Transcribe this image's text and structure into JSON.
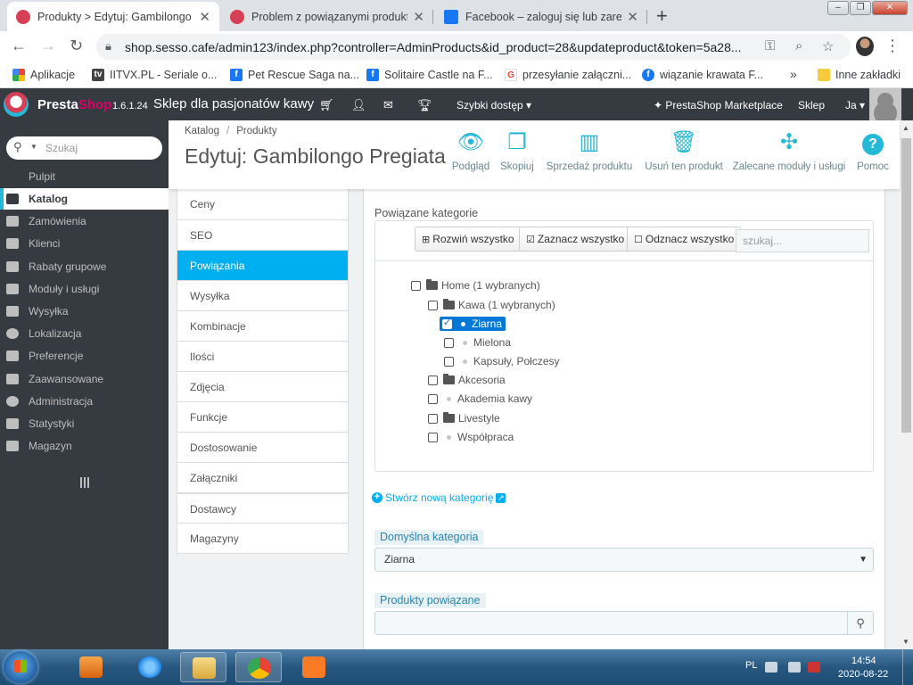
{
  "browser": {
    "tabs": [
      {
        "title": "Produkty > Edytuj: Gambilongo P",
        "active": true,
        "favicon_color": "#d63f54"
      },
      {
        "title": "Problem z powiązanymi produkta",
        "active": false,
        "favicon_color": "#d63f54"
      },
      {
        "title": "Facebook – zaloguj się lub zareje",
        "active": false,
        "favicon_color": "#1877f2"
      }
    ],
    "new_tab": "+",
    "url": "shop.sesso.cafe/admin123/index.php?controller=AdminProducts&id_product=28&updateproduct&token=5a28...",
    "bookmarks": [
      {
        "label": "Aplikacje",
        "icon": "apps-icon",
        "color": "#ea4335"
      },
      {
        "label": "IITVX.PL - Seriale o...",
        "icon": "tv-icon",
        "color": "#444444"
      },
      {
        "label": "Pet Rescue Saga na...",
        "icon": "facebook-icon",
        "color": "#1877f2"
      },
      {
        "label": "Solitaire Castle na F...",
        "icon": "facebook-icon",
        "color": "#1877f2"
      },
      {
        "label": "przesyłanie załączni...",
        "icon": "google-icon",
        "color": "#ea4335"
      },
      {
        "label": "wiązanie krawata  F...",
        "icon": "facebook-icon",
        "color": "#1877f2"
      },
      {
        "label": "»",
        "icon": "",
        "color": ""
      },
      {
        "label": "Inne zakładki",
        "icon": "folder-icon",
        "color": "#f9cb3c"
      }
    ]
  },
  "header": {
    "brand_presta": "Presta",
    "brand_shop": "Shop",
    "version": "1.6.1.24",
    "shop_name": "Sklep dla pasjonatów kawy",
    "quick_access": "Szybki dostęp ▾",
    "marketplace": "PrestaShop Marketplace",
    "shop_link": "Sklep",
    "employee": "Ja ▾"
  },
  "sidebar": {
    "search_placeholder": "Szukaj",
    "items": [
      {
        "label": "Pulpit",
        "type": "sub"
      },
      {
        "label": "Katalog",
        "type": "active"
      },
      {
        "label": "Zamówienia",
        "type": "main"
      },
      {
        "label": "Klienci",
        "type": "main"
      },
      {
        "label": "Rabaty grupowe",
        "type": "main"
      },
      {
        "label": "Moduły i usługi",
        "type": "main"
      },
      {
        "label": "Wysyłka",
        "type": "main"
      },
      {
        "label": "Lokalizacja",
        "type": "main"
      },
      {
        "label": "Preferencje",
        "type": "main"
      },
      {
        "label": "Zaawansowane",
        "type": "main"
      },
      {
        "label": "Administracja",
        "type": "main"
      },
      {
        "label": "Statystyki",
        "type": "main"
      },
      {
        "label": "Magazyn",
        "type": "main"
      }
    ]
  },
  "page": {
    "breadcrumb": [
      "Katalog",
      "Produkty"
    ],
    "title": "Edytuj: Gambilongo Pregiata",
    "toolbar": [
      {
        "label": "Podgląd",
        "icon": "eye-icon"
      },
      {
        "label": "Skopiuj",
        "icon": "copy-icon"
      },
      {
        "label": "Sprzedaż produktu",
        "icon": "bar-chart-icon"
      },
      {
        "label": "Usuń ten produkt",
        "icon": "trash-icon"
      },
      {
        "label": "Zalecane moduły i usługi",
        "icon": "puzzle-icon"
      },
      {
        "label": "Pomoc",
        "icon": "help-icon"
      }
    ]
  },
  "product_tabs": [
    {
      "label": "Ceny",
      "active": false
    },
    {
      "label": "SEO",
      "active": false
    },
    {
      "label": "Powiązania",
      "active": true
    },
    {
      "label": "Wysyłka",
      "active": false
    },
    {
      "label": "Kombinacje",
      "active": false
    },
    {
      "label": "Ilości",
      "active": false
    },
    {
      "label": "Zdjęcia",
      "active": false
    },
    {
      "label": "Funkcje",
      "active": false
    },
    {
      "label": "Dostosowanie",
      "active": false
    },
    {
      "label": "Załączniki",
      "active": false
    },
    {
      "label": "Dostawcy",
      "active": false
    },
    {
      "label": "Magazyny",
      "active": false
    }
  ],
  "associations": {
    "label": "Powiązane kategorie",
    "expand_all": "Rozwiń wszystko",
    "check_all": "Zaznacz wszystko",
    "uncheck_all": "Odznacz wszystko",
    "search_placeholder": "szukaj...",
    "tree": [
      {
        "label": "Home (1 wybranych)",
        "level": 0,
        "kind": "folder-open",
        "checked": false,
        "selected": false
      },
      {
        "label": "Kawa (1 wybranych)",
        "level": 1,
        "kind": "folder-open",
        "checked": false,
        "selected": false
      },
      {
        "label": "Ziarna",
        "level": 2,
        "kind": "leaf",
        "checked": true,
        "selected": true
      },
      {
        "label": "Mielona",
        "level": 2,
        "kind": "leaf",
        "checked": false,
        "selected": false
      },
      {
        "label": "Kapsuły, Połczesy",
        "level": 2,
        "kind": "leaf",
        "checked": false,
        "selected": false
      },
      {
        "label": "Akcesoria",
        "level": 1,
        "kind": "folder",
        "checked": false,
        "selected": false
      },
      {
        "label": "Akademia kawy",
        "level": 1,
        "kind": "leaf",
        "checked": false,
        "selected": false
      },
      {
        "label": "Livestyle",
        "level": 1,
        "kind": "folder",
        "checked": false,
        "selected": false
      },
      {
        "label": "Współpraca",
        "level": 1,
        "kind": "leaf",
        "checked": false,
        "selected": false
      }
    ],
    "create_category": "Stwórz nową kategorię",
    "default_category_label": "Domyślna kategoria",
    "default_category_value": "Ziarna",
    "related_products_label": "Produkty powiązane"
  },
  "taskbar": {
    "language": "PL",
    "time": "14:54",
    "date": "2020-08-22",
    "apps": [
      {
        "name": "media-player",
        "color": "#e07b1a",
        "open": false
      },
      {
        "name": "internet-explorer",
        "color": "#1e88e5",
        "open": false
      },
      {
        "name": "file-explorer",
        "color": "#e9c46a",
        "open": true
      },
      {
        "name": "chrome",
        "color": "#34a853",
        "open": true
      },
      {
        "name": "xampp",
        "color": "#fb7a24",
        "open": false
      }
    ]
  }
}
